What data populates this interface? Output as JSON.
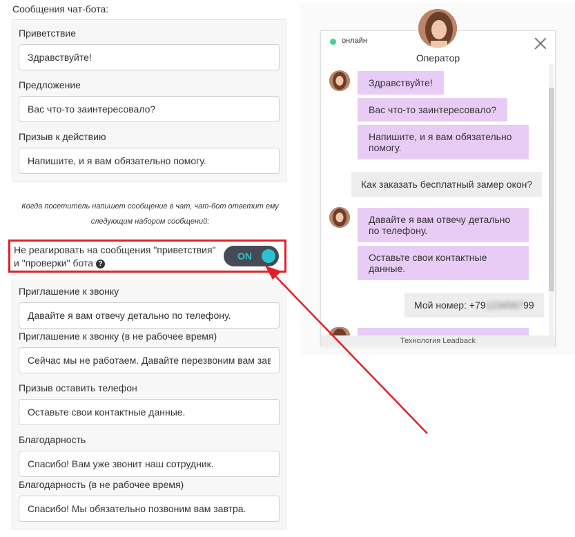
{
  "settings": {
    "section_title": "Сообщения чат-бота:",
    "greeting": {
      "label": "Приветствие",
      "value": "Здравствуйте!"
    },
    "offer": {
      "label": "Предложение",
      "value": "Вас что-то заинтересовало?"
    },
    "call_to_action": {
      "label": "Призыв к действию",
      "value": "Напишите, и я вам обязательно помогу."
    },
    "info_line1": "Когда посетитель напишет сообщение в чат, чат-бот ответит ему",
    "info_line2": "следующим набором сообщений:",
    "toggle": {
      "label_line1": "Не реагировать на сообщения \"приветствия\"",
      "label_line2": "и \"проверки\" бота",
      "help": "?",
      "state": "ON",
      "on": true
    },
    "call_invite": {
      "label": "Приглашение к звонку",
      "value": "Давайте я вам отвечу детально по телефону."
    },
    "call_invite_offhours": {
      "label": "Приглашение к звонку (в не рабочее время)",
      "value": "Сейчас мы не работаем. Давайте перезвоним вам завт"
    },
    "ask_phone": {
      "label": "Призыв оставить телефон",
      "value": "Оставьте свои контактные данные."
    },
    "thanks": {
      "label": "Благодарность",
      "value": "Спасибо! Вам уже звонит наш сотрудник."
    },
    "thanks_offhours": {
      "label": "Благодарность (в не рабочее время)",
      "value": "Спасибо! Мы обязательно позвоним вам завтра."
    }
  },
  "chat": {
    "status": "онлайн",
    "operator_name": "Оператор",
    "bot_messages_1": [
      "Здравствуйте!",
      "Вас что-то заинтересовало?",
      "Напишите, и я вам обязательно помогу."
    ],
    "user_message_1": "Как заказать бесплатный замер окон?",
    "bot_messages_2": [
      "Давайте я вам отвечу детально по телефону.",
      "Оставьте свои контактные данные."
    ],
    "user_phone_prefix": "Мой номер: +79",
    "user_phone_hidden": "1234567",
    "user_phone_suffix": "99",
    "footer": "Технология Leadback"
  },
  "colors": {
    "accent_red": "#e41e26",
    "toggle_bg": "#454a55",
    "toggle_on": "#2cc2cf",
    "bot_bubble": "#e8ccf6",
    "user_bubble": "#ededed",
    "online": "#3dd68c"
  },
  "icons": [
    "help-icon",
    "close-icon",
    "online-status-icon",
    "operator-avatar",
    "annotation-arrow"
  ]
}
